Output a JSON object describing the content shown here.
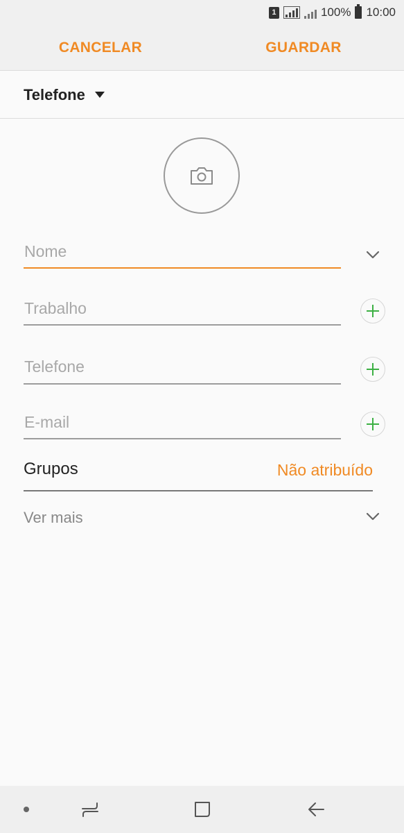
{
  "status_bar": {
    "sim_label": "1",
    "battery_text": "100%",
    "time": "10:00",
    "icons": [
      "sim-1-icon",
      "signal-framed-icon",
      "signal-icon",
      "battery-icon"
    ]
  },
  "toolbar": {
    "cancel_label": "CANCELAR",
    "save_label": "GUARDAR",
    "accent_color": "#f08a24"
  },
  "account": {
    "label": "Telefone",
    "icon": "dropdown-triangle-icon"
  },
  "photo": {
    "icon": "camera-icon"
  },
  "fields": {
    "name": {
      "placeholder": "Nome",
      "icon": "chevron-down-icon"
    },
    "work": {
      "placeholder": "Trabalho",
      "icon": "plus-icon"
    },
    "phone": {
      "placeholder": "Telefone",
      "icon": "plus-icon"
    },
    "email": {
      "placeholder": "E-mail",
      "icon": "plus-icon"
    }
  },
  "groups": {
    "label": "Grupos",
    "value": "Não atribuído"
  },
  "more": {
    "label": "Ver mais",
    "icon": "chevron-down-icon"
  },
  "nav": {
    "icons": [
      "dot-icon",
      "recents-icon",
      "home-icon",
      "back-icon"
    ]
  }
}
